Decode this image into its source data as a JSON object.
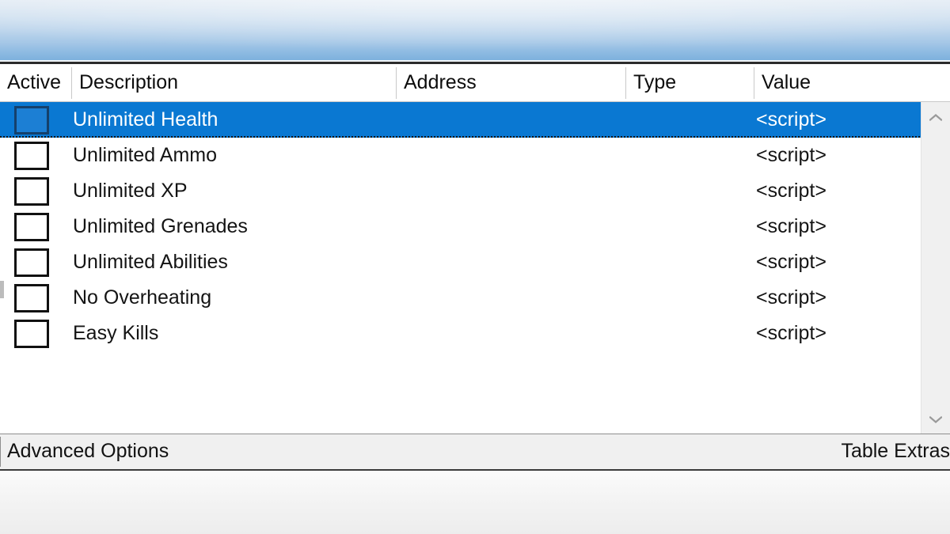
{
  "window": {
    "columns": [
      {
        "key": "active",
        "label": "Active"
      },
      {
        "key": "description",
        "label": "Description"
      },
      {
        "key": "address",
        "label": "Address"
      },
      {
        "key": "type",
        "label": "Type"
      },
      {
        "key": "value",
        "label": "Value"
      }
    ],
    "rows": [
      {
        "active": false,
        "description": "Unlimited Health",
        "address": "",
        "type": "",
        "value": "<script>",
        "selected": true
      },
      {
        "active": false,
        "description": "Unlimited Ammo",
        "address": "",
        "type": "",
        "value": "<script>",
        "selected": false
      },
      {
        "active": false,
        "description": "Unlimited XP",
        "address": "",
        "type": "",
        "value": "<script>",
        "selected": false
      },
      {
        "active": false,
        "description": "Unlimited Grenades",
        "address": "",
        "type": "",
        "value": "<script>",
        "selected": false
      },
      {
        "active": false,
        "description": "Unlimited Abilities",
        "address": "",
        "type": "",
        "value": "<script>",
        "selected": false
      },
      {
        "active": false,
        "description": "No Overheating",
        "address": "",
        "type": "",
        "value": "<script>",
        "selected": false
      },
      {
        "active": false,
        "description": "Easy Kills",
        "address": "",
        "type": "",
        "value": "<script>",
        "selected": false
      }
    ],
    "scrollbar": {
      "up_icon": "chevron-up-icon",
      "down_icon": "chevron-down-icon"
    },
    "status_bar": {
      "left_label": "Advanced Options",
      "right_label": "Table Extras"
    }
  },
  "colors": {
    "selection_blue": "#0a78d2",
    "banner_top": "#e2ebf4",
    "banner_bottom": "#7fb2dd",
    "status_bg": "#f0f0f0",
    "text": "#141414"
  }
}
